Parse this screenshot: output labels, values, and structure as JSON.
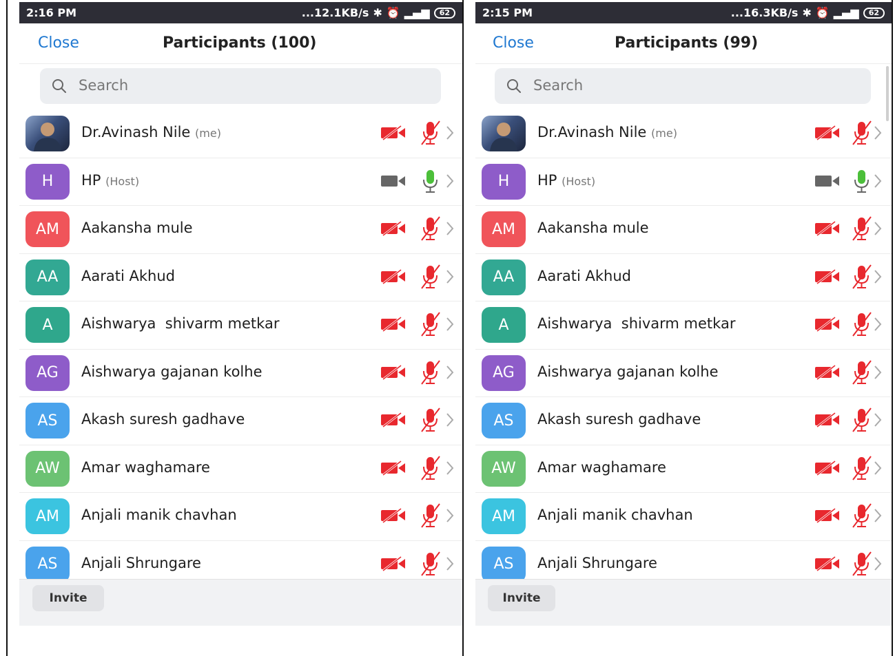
{
  "left": {
    "status": {
      "time": "2:16 PM",
      "speed": "...12.1KB/s",
      "battery": "62"
    },
    "close_label": "Close",
    "title": "Participants (100)",
    "search_placeholder": "Search",
    "invite_label": "Invite"
  },
  "right": {
    "status": {
      "time": "2:15 PM",
      "speed": "...16.3KB/s",
      "battery": "62"
    },
    "close_label": "Close",
    "title": "Participants (99)",
    "search_placeholder": "Search",
    "invite_label": "Invite"
  },
  "participants": [
    {
      "name": "Dr.Avinash Nile",
      "tag": "(me)",
      "initials": "",
      "photo": true,
      "color": "",
      "video_on": false,
      "mic_on": false
    },
    {
      "name": "HP",
      "tag": "(Host)",
      "initials": "H",
      "photo": false,
      "color": "#8e5cc9",
      "video_on": true,
      "mic_on": true
    },
    {
      "name": "Aakansha mule",
      "tag": "",
      "initials": "AM",
      "photo": false,
      "color": "#f0545a",
      "video_on": false,
      "mic_on": false
    },
    {
      "name": "Aarati Akhud",
      "tag": "",
      "initials": "AA",
      "photo": false,
      "color": "#32a893",
      "video_on": false,
      "mic_on": false
    },
    {
      "name": "Aishwarya  shivarm metkar",
      "tag": "",
      "initials": "A",
      "photo": false,
      "color": "#2fa78c",
      "video_on": false,
      "mic_on": false
    },
    {
      "name": "Aishwarya gajanan kolhe",
      "tag": "",
      "initials": "AG",
      "photo": false,
      "color": "#8e5cc9",
      "video_on": false,
      "mic_on": false
    },
    {
      "name": "Akash suresh gadhave",
      "tag": "",
      "initials": "AS",
      "photo": false,
      "color": "#4aa3ec",
      "video_on": false,
      "mic_on": false
    },
    {
      "name": "Amar waghamare",
      "tag": "",
      "initials": "AW",
      "photo": false,
      "color": "#6cc273",
      "video_on": false,
      "mic_on": false
    },
    {
      "name": "Anjali manik chavhan",
      "tag": "",
      "initials": "AM",
      "photo": false,
      "color": "#3bc4e0",
      "video_on": false,
      "mic_on": false
    },
    {
      "name": "Anjali Shrungare",
      "tag": "",
      "initials": "AS",
      "photo": false,
      "color": "#4aa3ec",
      "video_on": false,
      "mic_on": false
    }
  ],
  "colors": {
    "accent": "#1f78d1",
    "muted": "#e8282e",
    "active_mic": "#4cbf3a",
    "status_bar": "#2d2d36"
  }
}
